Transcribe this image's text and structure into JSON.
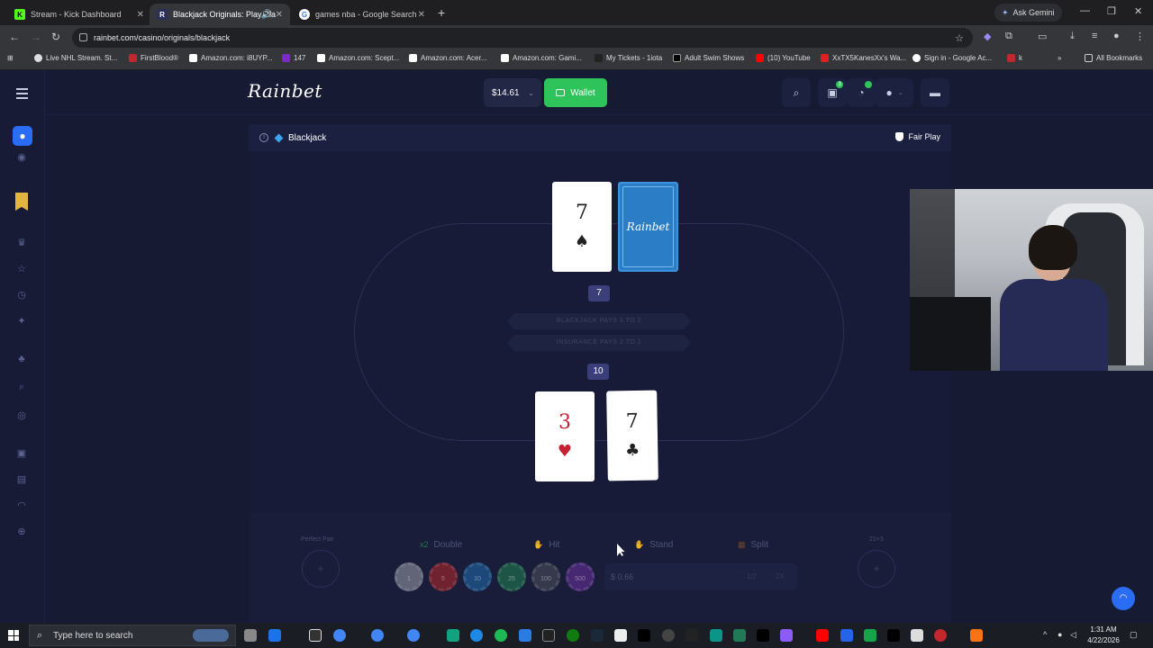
{
  "browser": {
    "tabs": [
      {
        "label": "Stream - Kick Dashboard",
        "active": false
      },
      {
        "label": "Blackjack Originals: Play Bla",
        "active": true
      },
      {
        "label": "games nba - Google Search",
        "active": false
      }
    ],
    "gemini_label": "Ask Gemini",
    "url": "rainbet.com/casino/originals/blackjack",
    "bookmarks": [
      "Live NHL Stream. St...",
      "FirstBlood®",
      "Amazon.com: i8UYP...",
      "147",
      "Amazon.com: Scept...",
      "Amazon.com: Acer...",
      "Amazon.com: Gami...",
      "My Tickets - 1iota",
      "Adult Swim Shows",
      "(10) YouTube",
      "XxTX5KanesXx's Wa...",
      "Sign in - Google Ac...",
      "k"
    ],
    "all_bookmarks_label": "All Bookmarks"
  },
  "site": {
    "logo": "Rainbet",
    "balance": "$14.61",
    "wallet_label": "Wallet",
    "gift_badge": "3",
    "game_title": "Blackjack",
    "fair_play_label": "Fair Play",
    "dealer": {
      "score": "7",
      "cards": [
        {
          "rank": "7",
          "suit": "♠"
        }
      ],
      "hidden_card_label": "Rainbet"
    },
    "ribbon_blackjack": "BLACKJACK PAYS 3 TO 2",
    "ribbon_insurance": "INSURANCE PAYS 2 TO 1",
    "player": {
      "score": "10",
      "cards": [
        {
          "rank": "3",
          "suit": "♥"
        },
        {
          "rank": "7",
          "suit": "♣"
        }
      ]
    },
    "controls": {
      "perfect_pair_label": "Perfect Pair",
      "double_prefix": "x2",
      "double_label": "Double",
      "hit_label": "Hit",
      "stand_label": "Stand",
      "split_label": "Split",
      "side_21_label": "21+3",
      "chips": [
        "1",
        "5",
        "10",
        "25",
        "100",
        "500"
      ],
      "bet_amount": "$ 0.66",
      "half_label": "1/2",
      "double_bet_label": "2X"
    }
  },
  "taskbar": {
    "search_placeholder": "Type here to search",
    "time": "1:31 AM",
    "date": "4/22/2026"
  },
  "colors": {
    "accent_blue": "#2a6df4",
    "wallet_green": "#2fc35b",
    "card_back": "#2b7dc6",
    "heart_red": "#c4202f",
    "site_bg": "#161a33"
  }
}
